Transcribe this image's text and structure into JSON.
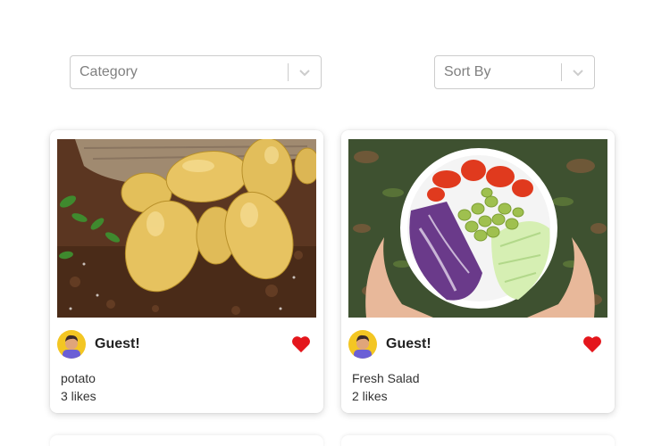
{
  "filters": {
    "category": {
      "placeholder": "Category"
    },
    "sort": {
      "placeholder": "Sort By"
    }
  },
  "posts": [
    {
      "author": "Guest!",
      "title": "potato",
      "likes": "3 likes",
      "image": "potatoes-photo",
      "liked": true
    },
    {
      "author": "Guest!",
      "title": "Fresh Salad",
      "likes": "2 likes",
      "image": "salad-bowl-photo",
      "liked": true
    }
  ],
  "colors": {
    "heart": "#e4161c",
    "border": "#cccccc",
    "placeholder": "#808080"
  },
  "icons": {
    "dropdown": "chevron-down-icon",
    "like": "heart-icon"
  }
}
